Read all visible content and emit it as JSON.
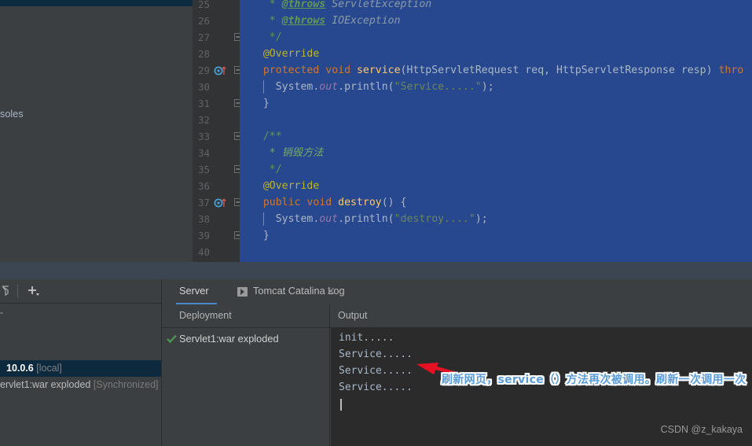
{
  "window": {
    "left_panel_truncated_label": "soles"
  },
  "editor": {
    "first_visible_line": 25,
    "lines": [
      {
        "num": 25,
        "fold": false,
        "runmark": false,
        "indent": 3,
        "segments": [
          {
            "text": "* ",
            "cls": "cm"
          },
          {
            "text": "@throws",
            "cls": "cm-tag"
          },
          {
            "text": " ServletException",
            "cls": "cm-it"
          }
        ]
      },
      {
        "num": 26,
        "fold": false,
        "runmark": false,
        "indent": 3,
        "segments": [
          {
            "text": "* ",
            "cls": "cm"
          },
          {
            "text": "@throws",
            "cls": "cm-tag"
          },
          {
            "text": " IOException",
            "cls": "cm-it"
          }
        ]
      },
      {
        "num": 27,
        "fold": true,
        "runmark": false,
        "indent": 3,
        "segments": [
          {
            "text": "*/",
            "cls": "cm"
          }
        ]
      },
      {
        "num": 28,
        "fold": false,
        "runmark": false,
        "indent": 2,
        "segments": [
          {
            "text": "@Override",
            "cls": "ann"
          }
        ]
      },
      {
        "num": 29,
        "fold": true,
        "runmark": true,
        "indent": 2,
        "segments": [
          {
            "text": "protected ",
            "cls": "kw"
          },
          {
            "text": "void ",
            "cls": "kw"
          },
          {
            "text": "service",
            "cls": "mth"
          },
          {
            "text": "(HttpServletRequest req, HttpServletResponse resp) ",
            "cls": "ident"
          },
          {
            "text": "thro",
            "cls": "kw"
          }
        ]
      },
      {
        "num": 30,
        "fold": false,
        "runmark": false,
        "indent": 4,
        "segments": [
          {
            "text": "System.",
            "cls": "ident"
          },
          {
            "text": "out",
            "cls": "fld"
          },
          {
            "text": ".println(",
            "cls": "ident"
          },
          {
            "text": "\"Service.....\"",
            "cls": "str"
          },
          {
            "text": ");",
            "cls": "ident"
          }
        ]
      },
      {
        "num": 31,
        "fold": true,
        "runmark": false,
        "indent": 2,
        "segments": [
          {
            "text": "}",
            "cls": "ident"
          }
        ]
      },
      {
        "num": 32,
        "fold": false,
        "runmark": false,
        "indent": 0,
        "segments": []
      },
      {
        "num": 33,
        "fold": true,
        "runmark": false,
        "indent": 2,
        "segments": [
          {
            "text": "/**",
            "cls": "cm"
          }
        ]
      },
      {
        "num": 34,
        "fold": false,
        "runmark": false,
        "indent": 3,
        "segments": [
          {
            "text": "* 销毁方法",
            "cls": "cm-plain"
          }
        ]
      },
      {
        "num": 35,
        "fold": true,
        "runmark": false,
        "indent": 3,
        "segments": [
          {
            "text": "*/",
            "cls": "cm"
          }
        ]
      },
      {
        "num": 36,
        "fold": false,
        "runmark": false,
        "indent": 2,
        "segments": [
          {
            "text": "@Override",
            "cls": "ann"
          }
        ]
      },
      {
        "num": 37,
        "fold": true,
        "runmark": true,
        "indent": 2,
        "segments": [
          {
            "text": "public ",
            "cls": "kw"
          },
          {
            "text": "void ",
            "cls": "kw"
          },
          {
            "text": "destroy",
            "cls": "mth"
          },
          {
            "text": "() {",
            "cls": "ident"
          }
        ]
      },
      {
        "num": 38,
        "fold": false,
        "runmark": false,
        "indent": 4,
        "segments": [
          {
            "text": "System.",
            "cls": "ident"
          },
          {
            "text": "out",
            "cls": "fld"
          },
          {
            "text": ".println(",
            "cls": "ident"
          },
          {
            "text": "\"destroy....\"",
            "cls": "str"
          },
          {
            "text": ");",
            "cls": "ident"
          }
        ]
      },
      {
        "num": 39,
        "fold": true,
        "runmark": false,
        "indent": 2,
        "segments": [
          {
            "text": "}",
            "cls": "ident"
          }
        ]
      },
      {
        "num": 40,
        "fold": false,
        "runmark": false,
        "indent": 0,
        "segments": []
      }
    ]
  },
  "services": {
    "toolbar": {
      "filter_icon": "filter-icon",
      "add_icon": "add-icon"
    },
    "tree": {
      "collapse_dash": "-",
      "selected_node": {
        "name": "10.0.6",
        "suffix": "[local]"
      },
      "child_node": {
        "name": "ervlet1:war exploded",
        "suffix": "[Synchronized]"
      }
    }
  },
  "server_panel": {
    "tabs": [
      {
        "label": "Server",
        "active": true,
        "closable": false,
        "icon": null
      },
      {
        "label": "Tomcat Catalina Log",
        "active": false,
        "closable": true,
        "icon": "console-icon"
      }
    ],
    "columns": {
      "deployment_header": "Deployment",
      "output_header": "Output"
    },
    "deployment": {
      "status_icon": "check-icon",
      "artifact": "Servlet1:war exploded"
    },
    "side_actions": [
      {
        "name": "deploy-icon",
        "enabled": true
      },
      {
        "name": "undeploy-icon",
        "enabled": false
      },
      {
        "name": "redeploy-icon",
        "enabled": true
      },
      {
        "name": "download-icon",
        "enabled": true
      }
    ],
    "output_lines": [
      "init.....",
      "Service.....",
      "Service.....",
      "Service....."
    ]
  },
  "annotations": {
    "arrow": "red-left-arrow",
    "arrow_color": "#e81123",
    "note_text": "刷新网页，service（）方法再次被调用。刷新一次调用一次",
    "note_color": "#5b9bd5"
  },
  "watermark": {
    "text": "CSDN @z_kakaya"
  },
  "colors": {
    "editor_selection_bg": "#27488e",
    "editor_bg": "#2b2b2b",
    "panel_bg": "#3c3f41",
    "accent_blue": "#4a88c7",
    "selected_row_bg": "#0d293e",
    "green": "#499c54"
  }
}
